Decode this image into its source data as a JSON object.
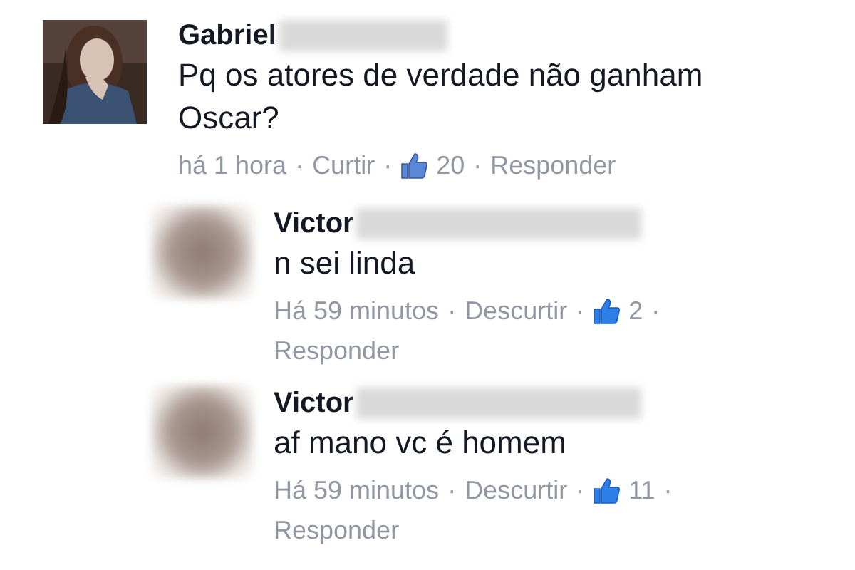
{
  "comments": [
    {
      "author": "Gabriel",
      "text": "Pq os atores de verdade não ganham Oscar?",
      "meta": [
        {
          "kind": "text",
          "text": "há 1 hora"
        },
        {
          "kind": "sep",
          "text": "·"
        },
        {
          "kind": "link",
          "text": "Curtir"
        },
        {
          "kind": "sep",
          "text": "·"
        },
        {
          "kind": "likes",
          "text": "20",
          "liked": false
        },
        {
          "kind": "sep",
          "text": "·"
        },
        {
          "kind": "link",
          "text": "Responder"
        }
      ],
      "replies": [
        {
          "avatar": {
            "kind": "blurred"
          },
          "author": "Victor",
          "text": "n sei linda",
          "meta": [
            {
              "kind": "text",
              "text": "Há 59 minutos"
            },
            {
              "kind": "sep",
              "text": "·"
            },
            {
              "kind": "link",
              "text": "Descurtir"
            },
            {
              "kind": "sep",
              "text": "·"
            },
            {
              "kind": "likes",
              "text": "2",
              "liked": true
            },
            {
              "kind": "sep",
              "text": "·"
            },
            {
              "kind": "link",
              "text": "Responder"
            }
          ]
        },
        {
          "avatar": {
            "kind": "blurred"
          },
          "author": "Victor",
          "text": "af mano vc é homem",
          "meta": [
            {
              "kind": "text",
              "text": "Há 59 minutos"
            },
            {
              "kind": "sep",
              "text": "·"
            },
            {
              "kind": "link",
              "text": "Descurtir"
            },
            {
              "kind": "sep",
              "text": "·"
            },
            {
              "kind": "likes",
              "text": "11",
              "liked": true
            },
            {
              "kind": "sep",
              "text": "·"
            },
            {
              "kind": "link",
              "text": "Responder"
            }
          ]
        }
      ]
    }
  ]
}
